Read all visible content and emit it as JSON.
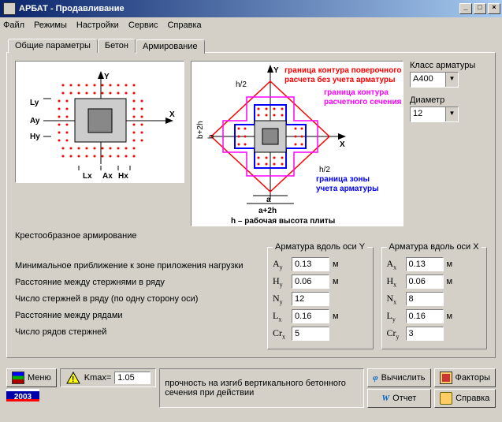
{
  "title": "АРБАТ - Продавливание",
  "menu": [
    "Файл",
    "Режимы",
    "Настройки",
    "Сервис",
    "Справка"
  ],
  "tabs": [
    "Общие параметры",
    "Бетон",
    "Армирование"
  ],
  "active_tab": 2,
  "subcaption": "Крестообразное армирование",
  "diag1_labels": {
    "Y": "Y",
    "X": "X",
    "Ly": "Ly",
    "Ay": "Ay",
    "Hy": "Hy",
    "Lx": "Lx",
    "Ax": "Ax",
    "Hx": "Hx"
  },
  "diag2_labels": {
    "Y": "Y",
    "X": "X",
    "h2": "h/2",
    "b": "b",
    "b2h": "b+2h",
    "a": "a",
    "a2h": "a+2h",
    "t_red1": "граница контура поверочного",
    "t_red2": "расчета без учета арматуры",
    "t_mag1": "граница контура",
    "t_mag2": "расчетного сечения",
    "t_blue1": "граница зоны",
    "t_blue2": "учета арматуры",
    "footer": "h – рабочая высота плиты"
  },
  "right": {
    "class_label": "Класс арматуры",
    "class_value": "A400",
    "diam_label": "Диаметр",
    "diam_value": "12"
  },
  "params": {
    "labels": [
      "Минимальное приближение к зоне приложения нагрузки",
      "Расстояние между стержнями в ряду",
      "Число стержней в ряду (по одну сторону оси)",
      "Расстояние между рядами",
      "Число рядов стержней"
    ],
    "group_y": "Арматура вдоль оси Y",
    "group_x": "Арматура вдоль оси X",
    "y": {
      "Ay": "0.13",
      "Hy": "0.06",
      "Ny": "12",
      "Lx": "0.16",
      "Crx": "5"
    },
    "x": {
      "Ax": "0.13",
      "Hx": "0.06",
      "Nx": "8",
      "Ly": "0.16",
      "Cry": "3"
    },
    "unit_m": "м"
  },
  "status": {
    "menu": "Меню",
    "kmax_label": "Kmax=",
    "kmax_value": "1.05",
    "year": "2003",
    "message": "прочность на изгиб вертикального бетонного сечения при действии",
    "calc": "Вычислить",
    "report": "Отчет",
    "factors": "Факторы",
    "help": "Справка"
  }
}
